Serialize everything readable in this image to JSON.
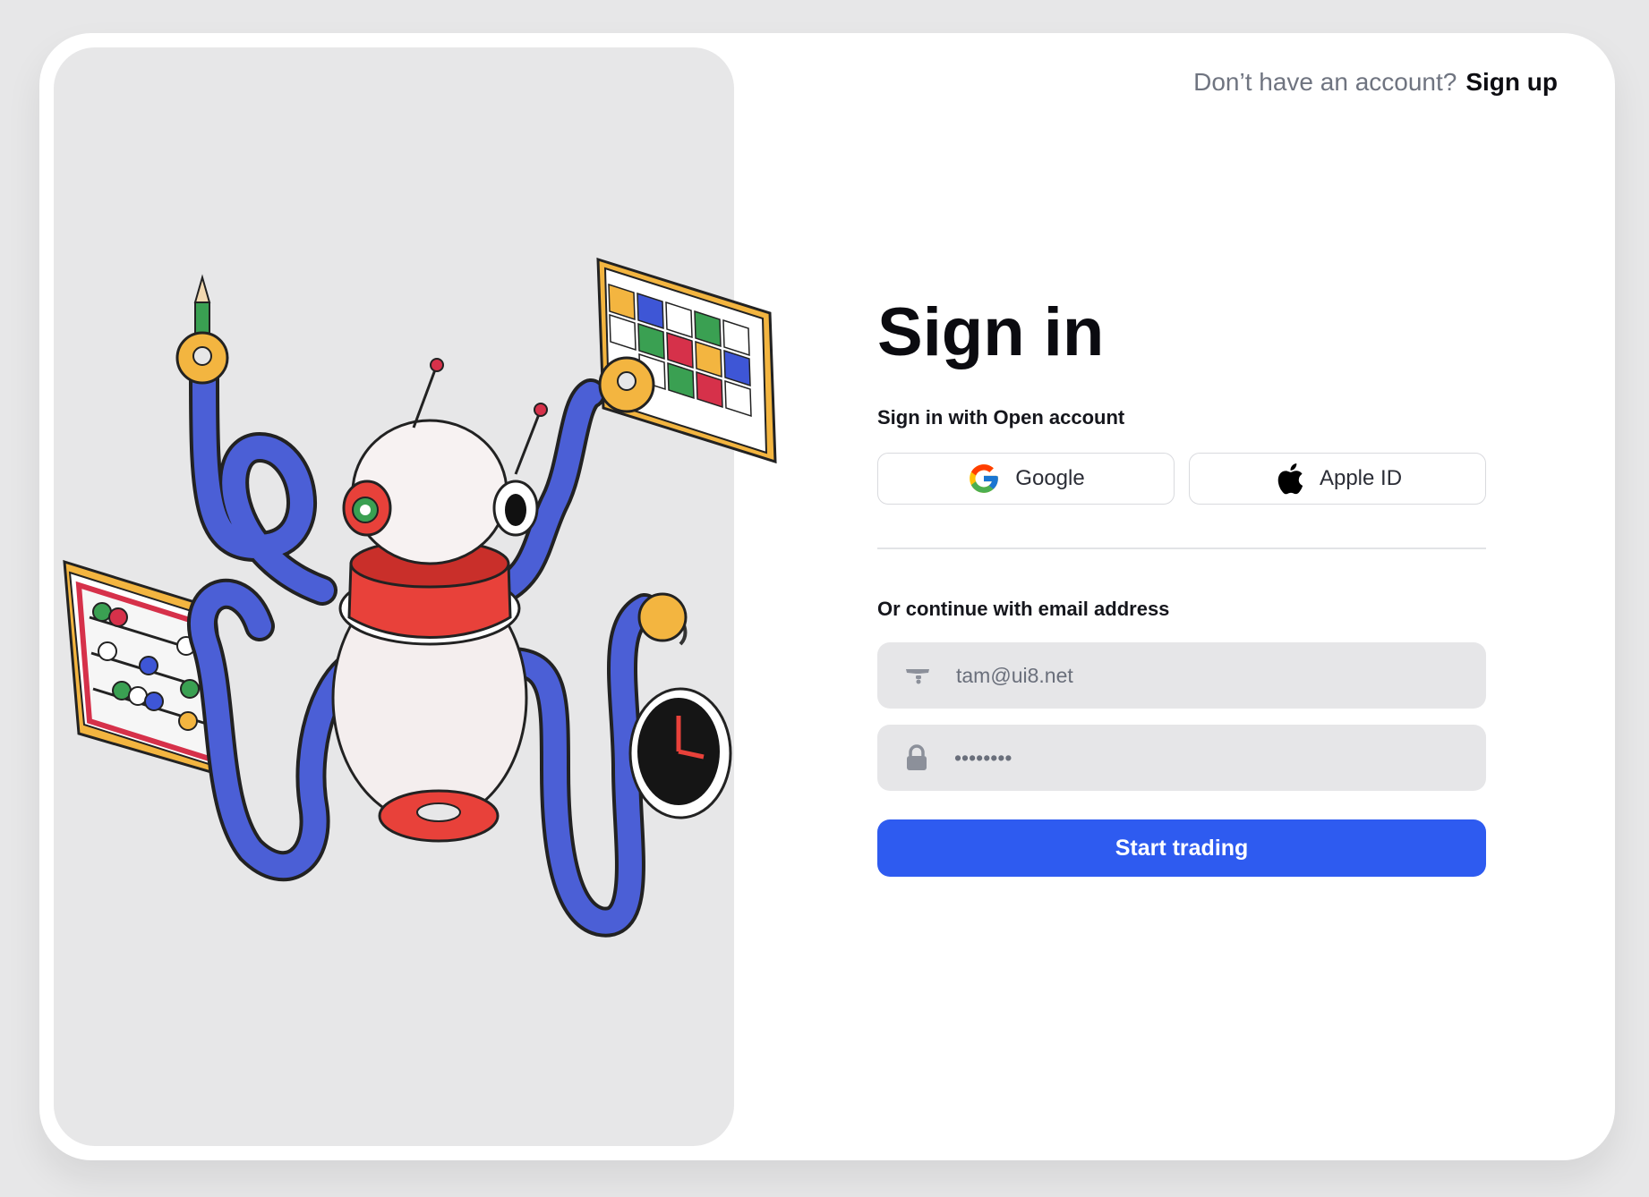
{
  "header": {
    "prompt": "Don’t have an account?",
    "signup_label": "Sign up"
  },
  "signin": {
    "title": "Sign in",
    "open_account_label": "Sign in with Open account",
    "google_label": "Google",
    "apple_label": "Apple ID",
    "email_label": "Or continue with email address",
    "email_value": "tam@ui8.net",
    "password_value": "••••••••",
    "submit_label": "Start trading"
  },
  "colors": {
    "accent": "#2e5bf0",
    "page_bg": "#e7e7e8",
    "card_bg": "#ffffff"
  },
  "icons": {
    "google": "google-logo-icon",
    "apple": "apple-logo-icon",
    "email": "mail-icon",
    "password": "lock-icon"
  }
}
